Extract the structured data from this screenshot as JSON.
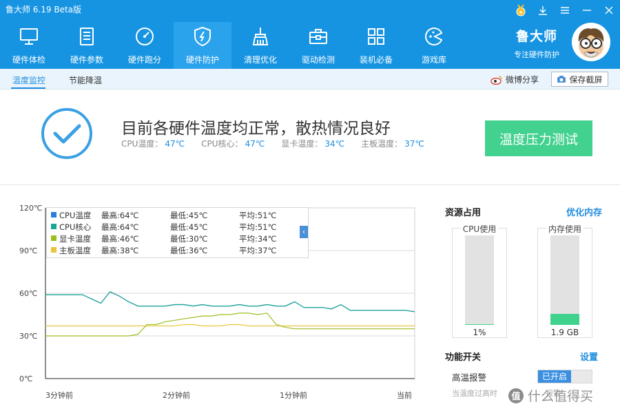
{
  "app": {
    "title": "鲁大师 6.19 Beta版",
    "brand_name": "鲁大师",
    "brand_slogan": "专注硬件防护"
  },
  "nav": {
    "items": [
      {
        "label": "硬件体检",
        "icon": "monitor-icon"
      },
      {
        "label": "硬件参数",
        "icon": "document-list-icon"
      },
      {
        "label": "硬件跑分",
        "icon": "speedometer-icon"
      },
      {
        "label": "硬件防护",
        "icon": "shield-icon",
        "active": true
      },
      {
        "label": "清理优化",
        "icon": "broom-icon"
      },
      {
        "label": "驱动检测",
        "icon": "toolbox-icon"
      },
      {
        "label": "装机必备",
        "icon": "apps-grid-icon"
      },
      {
        "label": "游戏库",
        "icon": "gamepad-icon"
      }
    ]
  },
  "subtabs": {
    "temp_monitor": "温度监控",
    "power_cool": "节能降温",
    "weibo_share": "微博分享",
    "save_screenshot": "保存截屏"
  },
  "status": {
    "headline": "目前各硬件温度均正常，散热情况良好",
    "temps": [
      {
        "label": "CPU温度：",
        "value": "47℃"
      },
      {
        "label": "CPU核心：",
        "value": "47℃"
      },
      {
        "label": "显卡温度：",
        "value": "34℃"
      },
      {
        "label": "主板温度：",
        "value": "37℃"
      }
    ],
    "stress_test_button": "温度压力测试"
  },
  "chart_data": {
    "type": "line",
    "ylim": [
      0,
      120
    ],
    "y_ticks": [
      "120℃",
      "90℃",
      "60℃",
      "30℃",
      "0℃"
    ],
    "x_ticks": [
      "3分钟前",
      "2分钟前",
      "1分钟前",
      "当前"
    ],
    "series": [
      {
        "name": "CPU温度",
        "color": "#2b7fd8",
        "max": "最高:64℃",
        "min": "最低:45℃",
        "avg": "平均:51℃",
        "values": [
          59,
          59,
          59,
          59,
          59,
          56,
          53,
          61,
          58,
          54,
          51,
          51,
          51,
          51,
          52,
          52,
          51,
          52,
          51,
          51,
          51,
          52,
          51,
          51,
          52,
          51,
          51,
          54,
          50,
          50,
          50,
          49,
          52,
          48,
          48,
          48,
          48,
          48,
          48,
          48,
          47
        ]
      },
      {
        "name": "CPU核心",
        "color": "#1aa593",
        "max": "最高:64℃",
        "min": "最低:45℃",
        "avg": "平均:51℃",
        "values": [
          59,
          59,
          59,
          59,
          59,
          56,
          53,
          61,
          58,
          54,
          51,
          51,
          51,
          51,
          52,
          52,
          51,
          52,
          51,
          51,
          51,
          52,
          51,
          51,
          52,
          51,
          51,
          54,
          50,
          50,
          50,
          49,
          52,
          48,
          48,
          48,
          48,
          48,
          48,
          48,
          47
        ]
      },
      {
        "name": "显卡温度",
        "color": "#9bbf1f",
        "max": "最高:46℃",
        "min": "最低:30℃",
        "avg": "平均:34℃",
        "values": [
          30,
          30,
          30,
          30,
          30,
          30,
          30,
          30,
          30,
          30,
          31,
          38,
          38,
          40,
          41,
          42,
          43,
          44,
          44,
          45,
          45,
          46,
          46,
          45,
          46,
          38,
          36,
          35,
          35,
          35,
          35,
          35,
          35,
          35,
          35,
          35,
          35,
          35,
          35,
          35,
          35
        ]
      },
      {
        "name": "主板温度",
        "color": "#e9c63c",
        "max": "最高:38℃",
        "min": "最低:36℃",
        "avg": "平均:37℃",
        "values": [
          37,
          37,
          37,
          37,
          37,
          37,
          37,
          37,
          37,
          37,
          37,
          37,
          37,
          37,
          37,
          38,
          38,
          37,
          37,
          37,
          38,
          38,
          37,
          37,
          37,
          37,
          37,
          37,
          37,
          37,
          37,
          37,
          37,
          37,
          37,
          37,
          37,
          37,
          37,
          37,
          37
        ]
      }
    ]
  },
  "resources": {
    "title": "资源占用",
    "optimize_link": "优化内存",
    "cpu_label": "CPU使用",
    "cpu_value": "1%",
    "cpu_fill": 0.01,
    "mem_label": "内存使用",
    "mem_value": "1.9 GB",
    "mem_fill": 0.12
  },
  "features": {
    "title": "功能开关",
    "settings_link": "设置",
    "high_temp_alarm": "高温报警",
    "toggle_on": "已开启",
    "hint": "当温度过高时",
    "hint_tail": "报警"
  },
  "watermark": {
    "text": "什么值得买",
    "badge": "值"
  },
  "colors": {
    "topbar": "#1694e2",
    "accent": "#1e8ddf",
    "green": "#42d18e"
  }
}
